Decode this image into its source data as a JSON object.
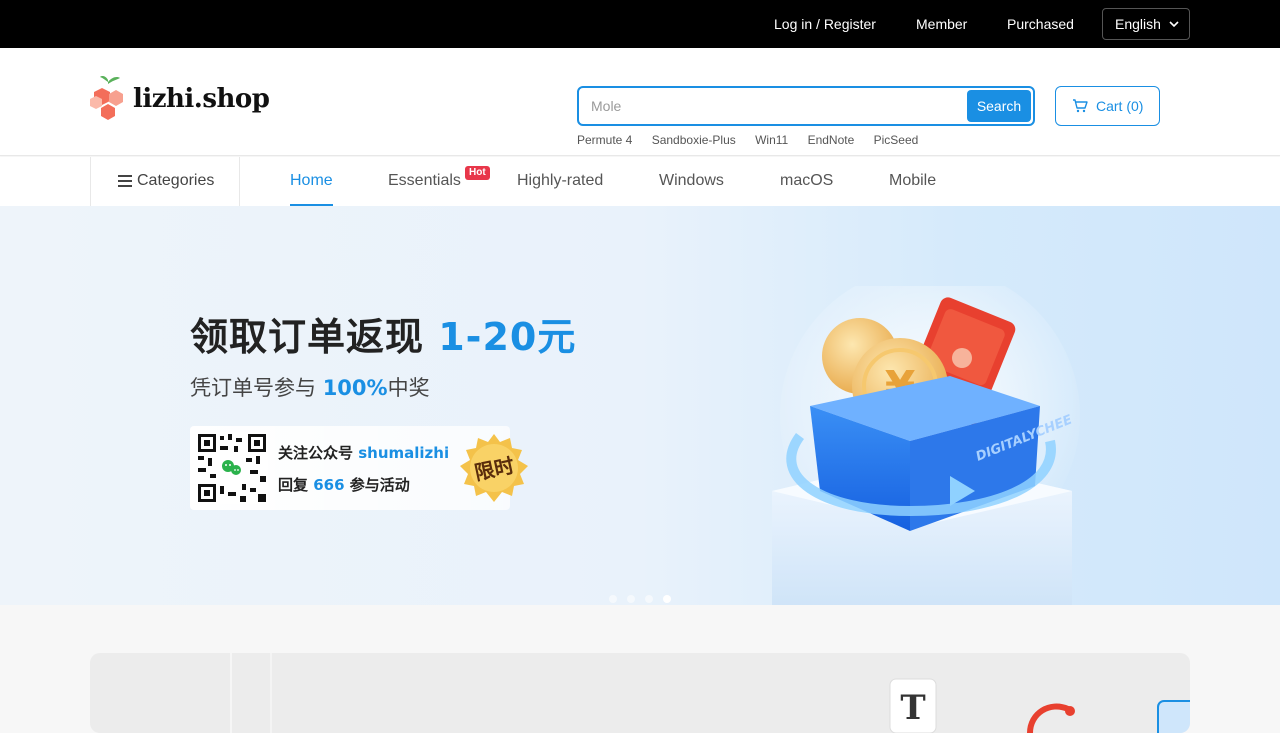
{
  "topbar": {
    "login": "Log in / Register",
    "member": "Member",
    "purchased": "Purchased",
    "language": "English"
  },
  "header": {
    "logo_text": "lizhi.shop",
    "search": {
      "placeholder": "Mole",
      "button": "Search"
    },
    "cart_label": "Cart (0)",
    "hot_searches": [
      "Permute 4",
      "Sandboxie-Plus",
      "Win11",
      "EndNote",
      "PicSeed"
    ]
  },
  "nav": {
    "categories": "Categories",
    "items": [
      "Home",
      "Essentials",
      "Highly-rated",
      "Windows",
      "macOS",
      "Mobile"
    ],
    "active": "Home",
    "hot_badge": "Hot"
  },
  "banner": {
    "title_main": "领取订单返现 ",
    "title_highlight": "1-20元",
    "sub_main": "凭订单号参与 ",
    "sub_highlight": "100%",
    "sub_tail": "中奖",
    "qr_line1_a": "关注公众号 ",
    "qr_line1_b": "shumalizhi",
    "qr_line2_a": "回复 ",
    "qr_line2_b": "666",
    "qr_line2_c": " 参与活动",
    "badge": "限时",
    "box_text": "DIGITALYCHEE",
    "slides": 4,
    "active_slide": 4
  },
  "colors": {
    "accent": "#1a8fe3",
    "topbar": "#000000",
    "hot": "#e8374a"
  }
}
